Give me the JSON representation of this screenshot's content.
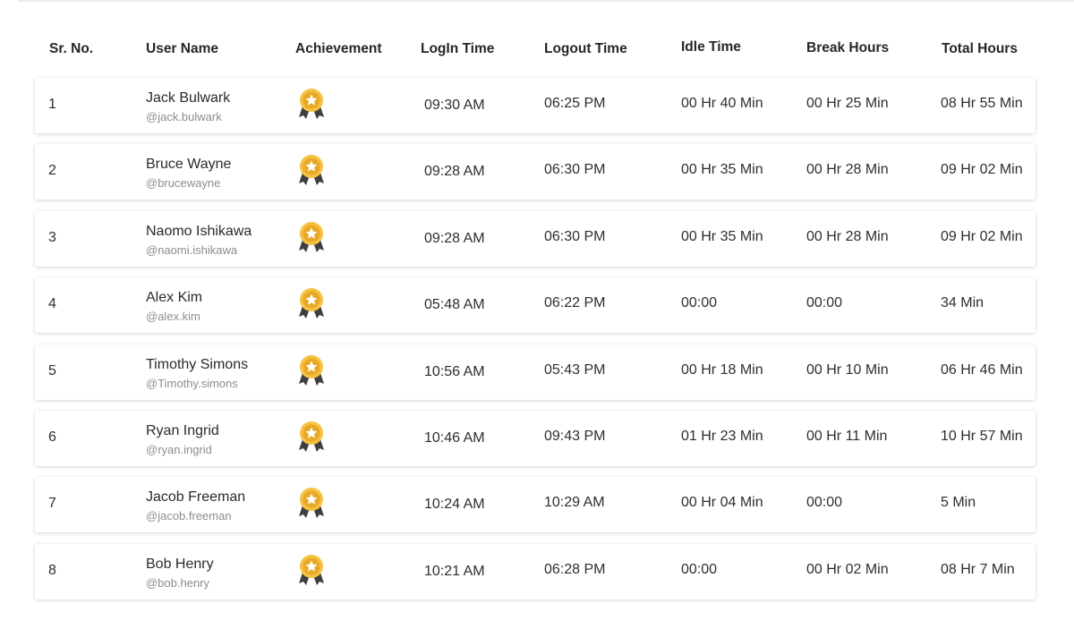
{
  "table": {
    "headers": {
      "sr": "Sr. No.",
      "user": "User Name",
      "achievement": "Achievement",
      "login": "LogIn Time",
      "logout": "Logout Time",
      "idle": "Idle Time",
      "break": "Break Hours",
      "total": "Total Hours"
    },
    "rows": [
      {
        "sr": "1",
        "name": "Jack Bulwark",
        "handle": "@jack.bulwark",
        "login": "09:30 AM",
        "logout": "06:25 PM",
        "idle": "00 Hr 40 Min",
        "break": "00 Hr 25 Min",
        "total": "08 Hr 55 Min"
      },
      {
        "sr": "2",
        "name": "Bruce Wayne",
        "handle": "@brucewayne",
        "login": "09:28 AM",
        "logout": "06:30 PM",
        "idle": "00 Hr 35 Min",
        "break": "00 Hr 28 Min",
        "total": "09 Hr 02 Min"
      },
      {
        "sr": "3",
        "name": "Naomo Ishikawa",
        "handle": "@naomi.ishikawa",
        "login": "09:28 AM",
        "logout": "06:30 PM",
        "idle": "00 Hr 35 Min",
        "break": "00 Hr 28 Min",
        "total": "09 Hr 02 Min"
      },
      {
        "sr": "4",
        "name": "Alex Kim",
        "handle": "@alex.kim",
        "login": "05:48 AM",
        "logout": "06:22 PM",
        "idle": "00:00",
        "break": "00:00",
        "total": "34 Min"
      },
      {
        "sr": "5",
        "name": "Timothy Simons",
        "handle": "@Timothy.simons",
        "login": "10:56 AM",
        "logout": "05:43 PM",
        "idle": "00 Hr 18 Min",
        "break": "00 Hr 10 Min",
        "total": "06 Hr 46 Min"
      },
      {
        "sr": "6",
        "name": "Ryan Ingrid",
        "handle": "@ryan.ingrid",
        "login": "10:46 AM",
        "logout": "09:43 PM",
        "idle": "01 Hr 23 Min",
        "break": "00 Hr 11 Min",
        "total": "10 Hr 57 Min"
      },
      {
        "sr": "7",
        "name": "Jacob Freeman",
        "handle": "@jacob.freeman",
        "login": "10:24 AM",
        "logout": "10:29 AM",
        "idle": "00 Hr 04 Min",
        "break": "00:00",
        "total": "5 Min"
      },
      {
        "sr": "8",
        "name": "Bob Henry",
        "handle": "@bob.henry",
        "login": "10:21 AM",
        "logout": "06:28 PM",
        "idle": "00:00",
        "break": "00 Hr 02 Min",
        "total": "08 Hr 7 Min"
      }
    ],
    "badge_icon": "award-medal-icon",
    "colors": {
      "badge_gold": "#f5c242",
      "badge_inner": "#e9a826",
      "ribbon": "#3f3f3f",
      "handle_text": "#8d8d8d"
    }
  }
}
